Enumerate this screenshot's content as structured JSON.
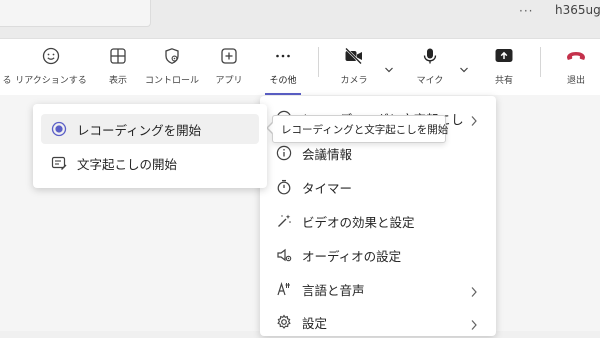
{
  "titlebar": {
    "more": "···",
    "user": "h365ug"
  },
  "toolbar": {
    "items": [
      {
        "label": "る"
      },
      {
        "label": "リアクションする"
      },
      {
        "label": "表示"
      },
      {
        "label": "コントロール"
      },
      {
        "label": "アプリ"
      },
      {
        "label": "その他"
      },
      {
        "label": "カメラ"
      },
      {
        "label": "マイク"
      },
      {
        "label": "共有"
      },
      {
        "label": "退出"
      }
    ]
  },
  "menu": {
    "items": [
      {
        "label": "レコーディングと文字起こし",
        "icon": "record-icon"
      },
      {
        "label": "会議情報",
        "icon": "info-icon"
      },
      {
        "label": "タイマー",
        "icon": "timer-icon"
      },
      {
        "label": "ビデオの効果と設定",
        "icon": "video-effects-icon"
      },
      {
        "label": "オーディオの設定",
        "icon": "audio-settings-icon"
      },
      {
        "label": "言語と音声",
        "icon": "language-icon"
      },
      {
        "label": "設定",
        "icon": "gear-icon"
      }
    ]
  },
  "tooltip": "レコーディングと文字起こしを開始",
  "submenu": {
    "items": [
      {
        "label": "レコーディングを開始",
        "icon": "record-start-icon"
      },
      {
        "label": "文字起こしの開始",
        "icon": "transcript-icon"
      }
    ]
  },
  "colors": {
    "accent": "#5b5fc7",
    "leave": "#c4314b",
    "menu_bg": "#ffffff"
  }
}
